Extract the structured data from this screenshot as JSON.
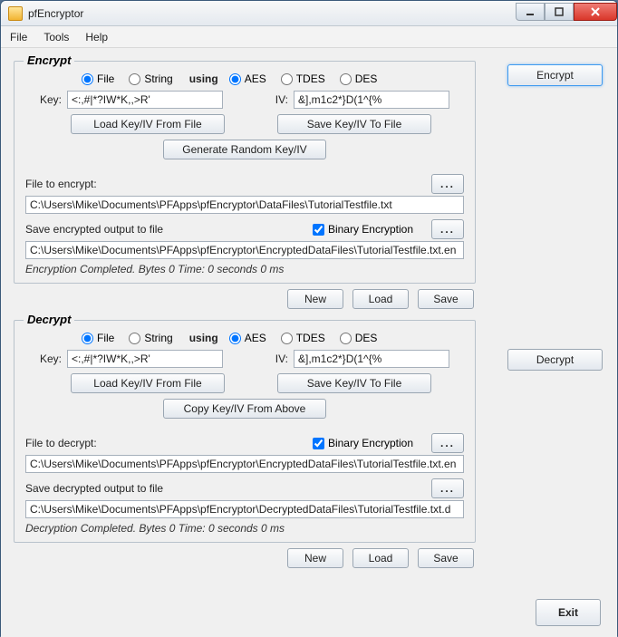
{
  "window": {
    "title": "pfEncryptor"
  },
  "menu": {
    "file": "File",
    "tools": "Tools",
    "help": "Help"
  },
  "common": {
    "file_radio": "File",
    "string_radio": "String",
    "using": "using",
    "aes": "AES",
    "tdes": "TDES",
    "des": "DES",
    "key_lbl": "Key:",
    "iv_lbl": "IV:",
    "load_keyiv": "Load Key/IV From File",
    "save_keyiv": "Save Key/IV To File",
    "binary": "Binary Encryption",
    "new": "New",
    "load": "Load",
    "save": "Save",
    "browse": "..."
  },
  "encrypt": {
    "legend": "Encrypt",
    "key": "<:,#|*?IW*K,,>R'",
    "iv": "&],m1c2*}D(1^{%",
    "gen_random": "Generate Random Key/IV",
    "file_to_encrypt_lbl": "File to encrypt:",
    "file_to_encrypt": "C:\\Users\\Mike\\Documents\\PFApps\\pfEncryptor\\DataFiles\\TutorialTestfile.txt",
    "save_out_lbl": "Save encrypted output to file",
    "save_out": "C:\\Users\\Mike\\Documents\\PFApps\\pfEncryptor\\EncryptedDataFiles\\TutorialTestfile.txt.en",
    "status": "Encryption Completed. Bytes  0  Time: 0 seconds 0 ms"
  },
  "decrypt": {
    "legend": "Decrypt",
    "key": "<:,#|*?IW*K,,>R'",
    "iv": "&],m1c2*}D(1^{%",
    "copy_above": "Copy Key/IV From Above",
    "file_to_decrypt_lbl": "File to decrypt:",
    "file_to_decrypt": "C:\\Users\\Mike\\Documents\\PFApps\\pfEncryptor\\EncryptedDataFiles\\TutorialTestfile.txt.en",
    "save_out_lbl": "Save decrypted output to file",
    "save_out": "C:\\Users\\Mike\\Documents\\PFApps\\pfEncryptor\\DecryptedDataFiles\\TutorialTestfile.txt.d",
    "status": "Decryption Completed. Bytes  0  Time: 0 seconds 0 ms"
  },
  "side": {
    "encrypt": "Encrypt",
    "decrypt": "Decrypt"
  },
  "exit": "Exit"
}
